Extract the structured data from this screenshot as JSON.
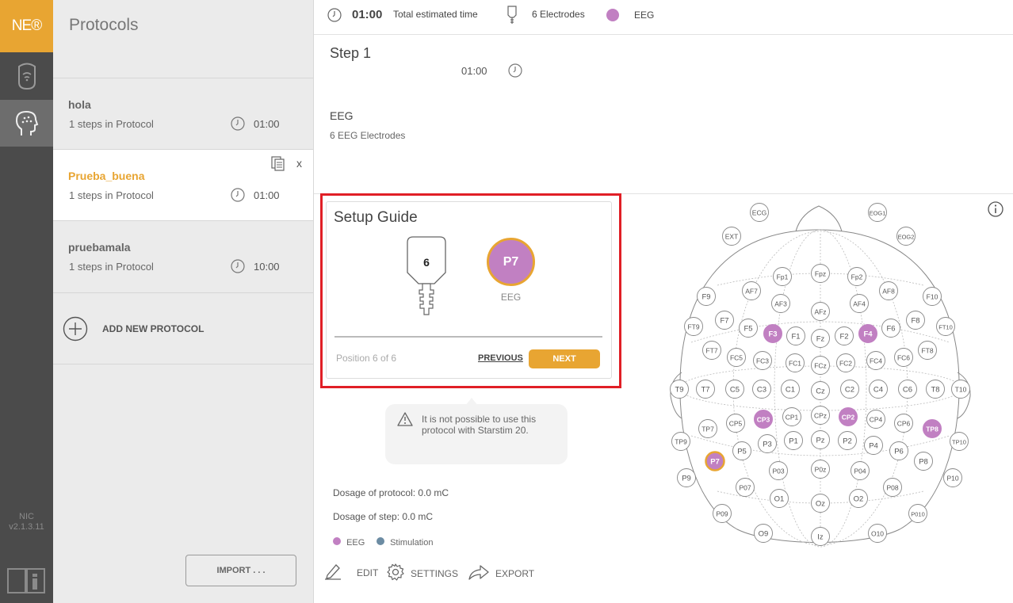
{
  "app": {
    "logo_text": "NE®",
    "version_name": "NIC",
    "version_number": "v2.1.3.11"
  },
  "sidebar": {
    "title": "Protocols",
    "protocols": [
      {
        "name": "hola",
        "steps": "1 steps in Protocol",
        "time": "01:00"
      },
      {
        "name": "Prueba_buena",
        "steps": "1 steps in Protocol",
        "time": "01:00"
      },
      {
        "name": "pruebamala",
        "steps": "1 steps in Protocol",
        "time": "10:00"
      }
    ],
    "close_label": "x",
    "add_label": "ADD NEW PROTOCOL",
    "import_label": "IMPORT . . ."
  },
  "topbar": {
    "time": "01:00",
    "time_label": "Total estimated time",
    "electrodes": "6 Electrodes",
    "mode": "EEG"
  },
  "step": {
    "title": "Step 1",
    "time": "01:00",
    "type": "EEG",
    "subtitle": "6 EEG Electrodes"
  },
  "guide": {
    "title": "Setup Guide",
    "cable_number": "6",
    "electrode": "P7",
    "electrode_type": "EEG",
    "position": "Position 6 of 6",
    "previous": "PREVIOUS",
    "next": "NEXT"
  },
  "warning": {
    "text": "It is not possible to use this protocol with Starstim 20."
  },
  "dosage": {
    "protocol": "Dosage of protocol: 0.0 mC",
    "step": "Dosage of step: 0.0 mC"
  },
  "legend": [
    {
      "label": "EEG",
      "color": "#c180c2"
    },
    {
      "label": "Stimulation",
      "color": "#6c8ca3"
    }
  ],
  "actions": {
    "edit": "EDIT",
    "settings": "SETTINGS",
    "export": "EXPORT"
  },
  "colors": {
    "accent": "#e8a532",
    "eeg": "#c180c2",
    "alert": "#e01f26"
  },
  "electrodes": [
    {
      "label": "ECG",
      "active": false
    },
    {
      "label": "EOG1",
      "active": false
    },
    {
      "label": "EXT",
      "active": false
    },
    {
      "label": "EOG2",
      "active": false
    },
    {
      "label": "Fp1",
      "active": false
    },
    {
      "label": "Fpz",
      "active": false
    },
    {
      "label": "Fp2",
      "active": false
    },
    {
      "label": "AF7",
      "active": false
    },
    {
      "label": "AF8",
      "active": false
    },
    {
      "label": "F9",
      "active": false
    },
    {
      "label": "F10",
      "active": false
    },
    {
      "label": "AF3",
      "active": false
    },
    {
      "label": "AF4",
      "active": false
    },
    {
      "label": "AFz",
      "active": false
    },
    {
      "label": "F7",
      "active": false
    },
    {
      "label": "F8",
      "active": false
    },
    {
      "label": "FT9",
      "active": false
    },
    {
      "label": "FT10",
      "active": false
    },
    {
      "label": "F5",
      "active": false
    },
    {
      "label": "F3",
      "active": true
    },
    {
      "label": "F1",
      "active": false
    },
    {
      "label": "Fz",
      "active": false
    },
    {
      "label": "F2",
      "active": false
    },
    {
      "label": "F4",
      "active": true
    },
    {
      "label": "F6",
      "active": false
    },
    {
      "label": "FT7",
      "active": false
    },
    {
      "label": "FT8",
      "active": false
    },
    {
      "label": "FC5",
      "active": false
    },
    {
      "label": "FC3",
      "active": false
    },
    {
      "label": "FC1",
      "active": false
    },
    {
      "label": "FCz",
      "active": false
    },
    {
      "label": "FC2",
      "active": false
    },
    {
      "label": "FC4",
      "active": false
    },
    {
      "label": "FC6",
      "active": false
    },
    {
      "label": "T9",
      "active": false
    },
    {
      "label": "T7",
      "active": false
    },
    {
      "label": "C5",
      "active": false
    },
    {
      "label": "C3",
      "active": false
    },
    {
      "label": "C1",
      "active": false
    },
    {
      "label": "Cz",
      "active": false
    },
    {
      "label": "C2",
      "active": false
    },
    {
      "label": "C4",
      "active": false
    },
    {
      "label": "C6",
      "active": false
    },
    {
      "label": "T8",
      "active": false
    },
    {
      "label": "T10",
      "active": false
    },
    {
      "label": "TP7",
      "active": false
    },
    {
      "label": "CP5",
      "active": false
    },
    {
      "label": "CP3",
      "active": true
    },
    {
      "label": "CP1",
      "active": false
    },
    {
      "label": "CPz",
      "active": false
    },
    {
      "label": "CP2",
      "active": true
    },
    {
      "label": "CP4",
      "active": false
    },
    {
      "label": "CP6",
      "active": false
    },
    {
      "label": "TP8",
      "active": true
    },
    {
      "label": "TP9",
      "active": false
    },
    {
      "label": "TP10",
      "active": false
    },
    {
      "label": "P7",
      "active": true,
      "selected": true
    },
    {
      "label": "P5",
      "active": false
    },
    {
      "label": "P3",
      "active": false
    },
    {
      "label": "P1",
      "active": false
    },
    {
      "label": "Pz",
      "active": false
    },
    {
      "label": "P2",
      "active": false
    },
    {
      "label": "P4",
      "active": false
    },
    {
      "label": "P6",
      "active": false
    },
    {
      "label": "P8",
      "active": false
    },
    {
      "label": "P9",
      "active": false
    },
    {
      "label": "P10",
      "active": false
    },
    {
      "label": "P07",
      "active": false
    },
    {
      "label": "P03",
      "active": false
    },
    {
      "label": "P0z",
      "active": false
    },
    {
      "label": "P04",
      "active": false
    },
    {
      "label": "P08",
      "active": false
    },
    {
      "label": "O1",
      "active": false
    },
    {
      "label": "Oz",
      "active": false
    },
    {
      "label": "O2",
      "active": false
    },
    {
      "label": "P09",
      "active": false
    },
    {
      "label": "P010",
      "active": false
    },
    {
      "label": "O9",
      "active": false
    },
    {
      "label": "Iz",
      "active": false
    },
    {
      "label": "O10",
      "active": false
    }
  ]
}
